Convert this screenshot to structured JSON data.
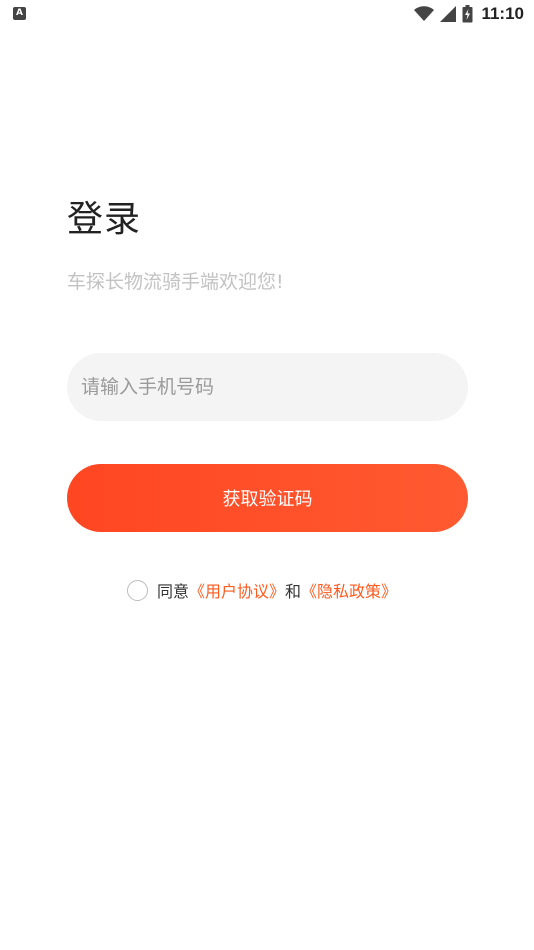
{
  "status_bar": {
    "app_icon_letter": "A",
    "time": "11:10"
  },
  "login": {
    "title": "登录",
    "subtitle": "车探长物流骑手端欢迎您!",
    "phone_placeholder": "请输入手机号码",
    "phone_value": "",
    "get_code_label": "获取验证码"
  },
  "agreement": {
    "checked": false,
    "prefix": "同意",
    "user_agreement": "《用户协议》",
    "conjunction": "和",
    "privacy_policy": "《隐私政策》"
  },
  "colors": {
    "accent": "#ff4f2a",
    "link": "#ff5a1f",
    "input_bg": "#f4f4f4",
    "subtitle": "#c2c2c2"
  }
}
